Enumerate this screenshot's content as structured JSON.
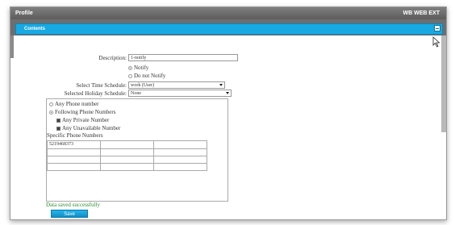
{
  "window": {
    "title": "Profile",
    "right_label": "WB WEB EXT"
  },
  "section": {
    "title": "Contents",
    "collapse_icon": "collapse-icon"
  },
  "form": {
    "description_label": "Description:",
    "description_value": "1-notify",
    "notify_options": [
      {
        "label": "Notify",
        "selected": true
      },
      {
        "label": "Do not Notify",
        "selected": false
      }
    ],
    "time_schedule_label": "Select Time Schedule:",
    "time_schedule_value": "work (User)",
    "holiday_schedule_label": "Selected Holiday Schedule:",
    "holiday_schedule_value": "None",
    "phone_options": [
      {
        "label": "Any Phone number",
        "selected": false
      },
      {
        "label": "Following Phone Numbers",
        "selected": true
      }
    ],
    "checkboxes": [
      {
        "label": "Any Private Number",
        "checked": true
      },
      {
        "label": "Any Unavailable Number",
        "checked": true
      }
    ],
    "specific_label": "Specific Phone Numbers",
    "phone_grid": [
      [
        "5219468373",
        "",
        ""
      ],
      [
        "",
        "",
        ""
      ],
      [
        "",
        "",
        ""
      ],
      [
        "",
        "",
        ""
      ]
    ]
  },
  "status_message": "Data saved successfully",
  "save_label": "Save"
}
